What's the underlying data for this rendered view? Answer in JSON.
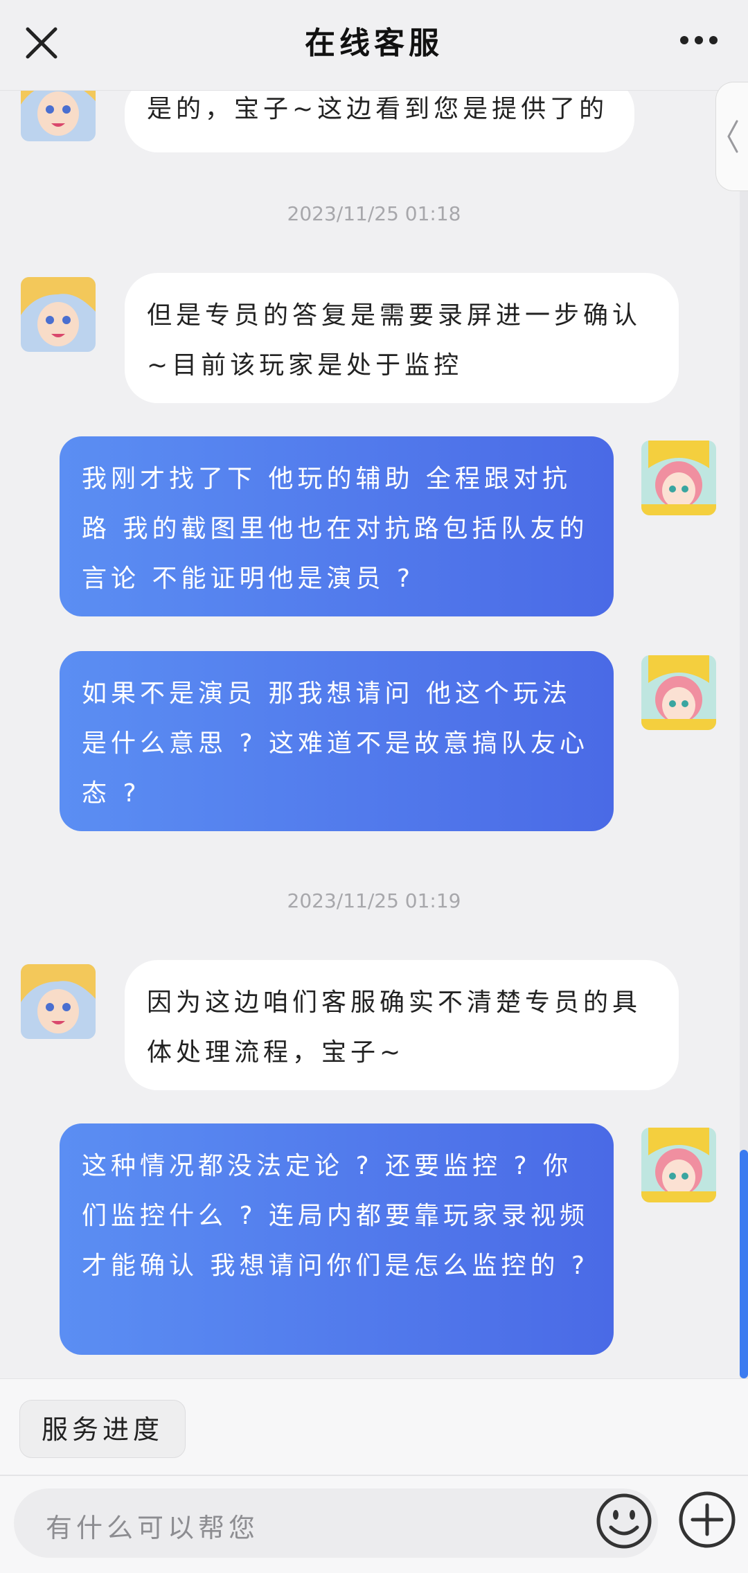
{
  "header": {
    "title": "在线客服"
  },
  "messages": {
    "agent_1": "是的，宝子~这边看到您是提供了的",
    "ts_1": "2023/11/25 01:18",
    "agent_2": "但是专员的答复是需要录屏进一步确认~目前该玩家是处于监控",
    "user_1": "我刚才找了下 他玩的辅助 全程跟对抗路 我的截图里他也在对抗路包括队友的言论 不能证明他是演员 ?",
    "user_2": "如果不是演员 那我想请问 他这个玩法是什么意思 ? 这难道不是故意搞队友心态 ?",
    "ts_2": "2023/11/25 01:19",
    "agent_3": "因为这边咱们客服确实不清楚专员的具体处理流程，宝子~",
    "user_3": "这种情况都没法定论 ? 还要监控 ? 你们监控什么 ? 连局内都要靠玩家录视频才能确认 我想请问你们是怎么监控的 ?"
  },
  "quick_actions": {
    "progress": "服务进度"
  },
  "input": {
    "placeholder": "有什么可以帮您"
  },
  "colors": {
    "user_bubble_start": "#5b8ef3",
    "user_bubble_end": "#4a6ae6",
    "scroll_accent": "#3b7bf0"
  },
  "icons": {
    "close": "close-icon",
    "more": "more-icon",
    "drawer": "chevron-left-icon",
    "emoji": "emoji-icon",
    "plus": "plus-icon"
  }
}
